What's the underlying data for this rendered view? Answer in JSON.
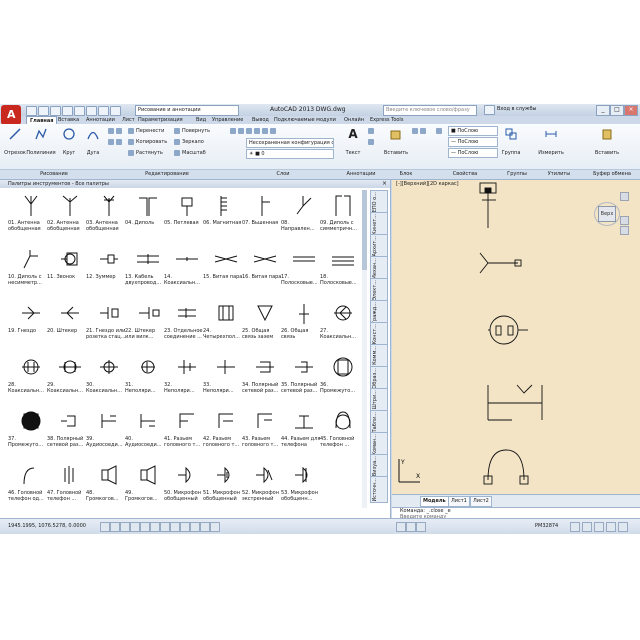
{
  "titlebar": {
    "workspace": "Рисование и аннотации",
    "title": "AutoCAD 2013   DWG.dwg",
    "search_placeholder": "Введите ключевое слово/фразу",
    "signin": "Вход в службы"
  },
  "tabs": [
    "Главная",
    "Вставка",
    "Аннотации",
    "Лист",
    "Параметризация",
    "Вид",
    "Управление",
    "Вывод",
    "Подключаемые модули",
    "Онлайн",
    "Express Tools"
  ],
  "ribbon": {
    "draw_tools": [
      "Отрезок",
      "Полилиния",
      "Круг",
      "Дуга"
    ],
    "modify_tools": [
      "Перенести",
      "Повернуть",
      "Копировать",
      "Зеркало",
      "Растянуть",
      "Масштаб"
    ],
    "layer_combo": "Несохраненная конфигурация сло",
    "text_label": "Текст",
    "insert_label": "Вставить",
    "bylayer_1": "ПоСлою",
    "bylayer_2": "ПоСлою",
    "bylayer_3": "ПоСлою",
    "group_label": "Группа",
    "measure_label": "Измерить",
    "paste_label": "Вставить",
    "panels": [
      "Рисование",
      "Редактирование",
      "Слои",
      "Аннотации",
      "Блок",
      "Свойства",
      "Группы",
      "Утилиты",
      "Буфер обмена"
    ]
  },
  "palette": {
    "title": "Палитры инструментов - Все палитры",
    "items": [
      "01. Антенна обобщенная",
      "02. Антенна обобщенная",
      "03. Антенна обобщенная",
      "04. Диполь",
      "05. Петлевая",
      "06. Магнитная",
      "07. Вьшенная",
      "08. Направлен...",
      "09. Диполь с симметричн...",
      "10. Диполь с несимметр...",
      "11. Звонок",
      "12. Зуммер",
      "13. Кабель двухпровод...",
      "14. Коаксиальн...",
      "15. Витая пара",
      "16. Витая пара",
      "17. Полосковые...",
      "18. Полосковые...",
      "19. Гнездо",
      "20. Штекер",
      "21. Гнездо или розетка стац...",
      "22. Штекер или вилк...",
      "23. Отдельное соединение ...",
      "24. Четырехпол...",
      "25. Общая связь зазем",
      "26. Общая связь",
      "27. Коаксиальн...",
      "28. Коаксиальн...",
      "29. Коаксиальн...",
      "30. Коаксиальн...",
      "31. Неполяри...",
      "32. Неполяри...",
      "33. Неполяри...",
      "34. Полярный сетевой раз...",
      "35. Полярный сетевой раз...",
      "36. Промежуто...",
      "37. Промежуто...",
      "38. Полярный сетевой раз...",
      "39. Аудиосоеди...",
      "40. Аудиосоеди...",
      "41. Разьем головного т...",
      "42. Разьем головного т...",
      "43. Разьем головного т...",
      "44. Разьем для телефона",
      "45. Головной телефон ...",
      "46. Головной телефон од...",
      "47. Головной телефон ...",
      "48. Громкогов...",
      "49. Громкогов...",
      "50. Микрофон обобщенный",
      "51. Микрофон обобщенный",
      "52. Микрофон экстренный",
      "53. Микрофон обобщенн...",
      ""
    ],
    "side_tabs": [
      "ЕПО о...",
      "Кинет...",
      "Архит...",
      "Механ...",
      "Элект...",
      "Гражд...",
      "Конст...",
      "Комм...",
      "Образ...",
      "Штри...",
      "Табли...",
      "Коман...",
      "Визуа...",
      "Источн..."
    ]
  },
  "viewport": {
    "view_label": "[-][Верхний][2D каркас]",
    "cube_face": "Верх",
    "layout_tabs": [
      "Модель",
      "Лист1",
      "Лист2"
    ]
  },
  "command": {
    "label": "Команда:  _.close _e",
    "input_placeholder": "Введите команду"
  },
  "status": {
    "coords": "1945.1995, 1076.5278, 0.0000",
    "scale": "РМ32874"
  }
}
